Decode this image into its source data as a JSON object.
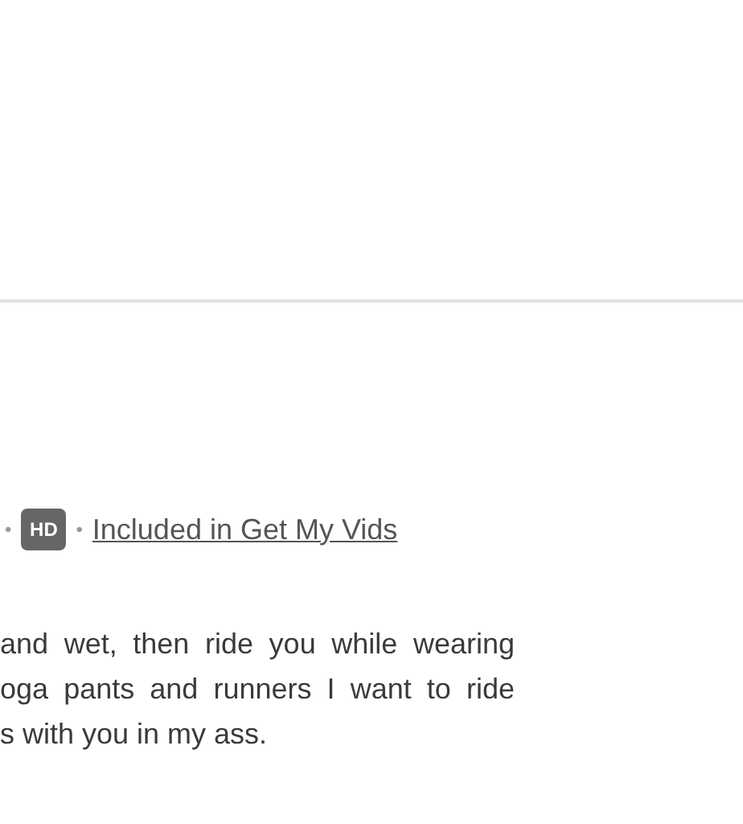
{
  "meta": {
    "separator": "•",
    "badge": "HD",
    "link": "Included in Get My Vids"
  },
  "description_lines": [
    "and wet, then ride you while wearing",
    "oga pants and runners I want to ride",
    "s with you in my ass."
  ]
}
